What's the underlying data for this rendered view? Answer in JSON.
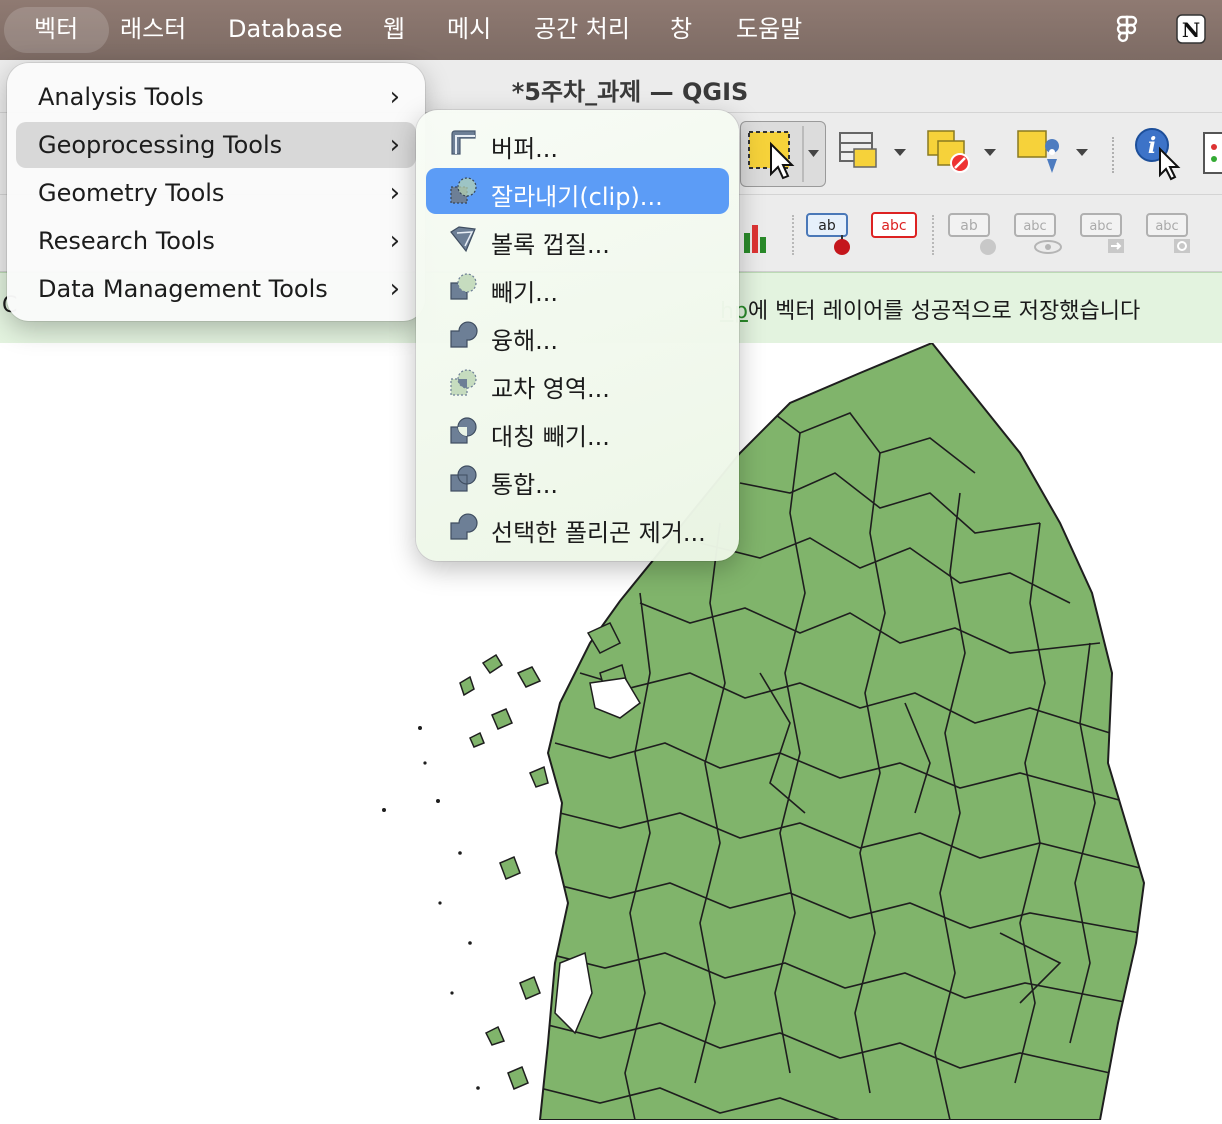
{
  "menubar": {
    "items": [
      "벡터",
      "래스터",
      "Database",
      "웹",
      "메시",
      "공간 처리",
      "창",
      "도움말"
    ],
    "active": "벡터",
    "right_icons": [
      "figma-icon",
      "notion-icon"
    ]
  },
  "window": {
    "title": "*5주차_과제 — QGIS"
  },
  "message_bar": {
    "left_fragment": "C",
    "link_fragment": "hp",
    "text": "에 벡터 레이어를 성공적으로 저장했습니다"
  },
  "vector_menu": {
    "items": [
      {
        "label": "Analysis Tools",
        "submenu": true
      },
      {
        "label": "Geoprocessing Tools",
        "submenu": true,
        "highlighted": true
      },
      {
        "label": "Geometry Tools",
        "submenu": true
      },
      {
        "label": "Research Tools",
        "submenu": true
      },
      {
        "label": "Data Management Tools",
        "submenu": true
      }
    ]
  },
  "geoprocessing_submenu": {
    "items": [
      {
        "label": "버퍼...",
        "icon": "buffer-icon"
      },
      {
        "label": "잘라내기(clip)...",
        "icon": "clip-icon",
        "selected": true
      },
      {
        "label": "볼록 껍질...",
        "icon": "convex-hull-icon"
      },
      {
        "label": "빼기...",
        "icon": "difference-icon"
      },
      {
        "label": "융해...",
        "icon": "dissolve-icon"
      },
      {
        "label": "교차 영역...",
        "icon": "intersection-icon"
      },
      {
        "label": "대칭 빼기...",
        "icon": "symmetric-difference-icon"
      },
      {
        "label": "통합...",
        "icon": "union-icon"
      },
      {
        "label": "선택한 폴리곤 제거...",
        "icon": "eliminate-polygons-icon"
      }
    ]
  },
  "toolbar": {
    "label_icons": [
      "ab",
      "abc",
      "ab",
      "abc",
      "abc",
      "abc"
    ]
  },
  "colors": {
    "menubar": "#85726b",
    "selection": "#5c9cf6",
    "map_fill": "#80b46b",
    "map_stroke": "#1e1e1e",
    "message_bar": "#e3f3df"
  }
}
